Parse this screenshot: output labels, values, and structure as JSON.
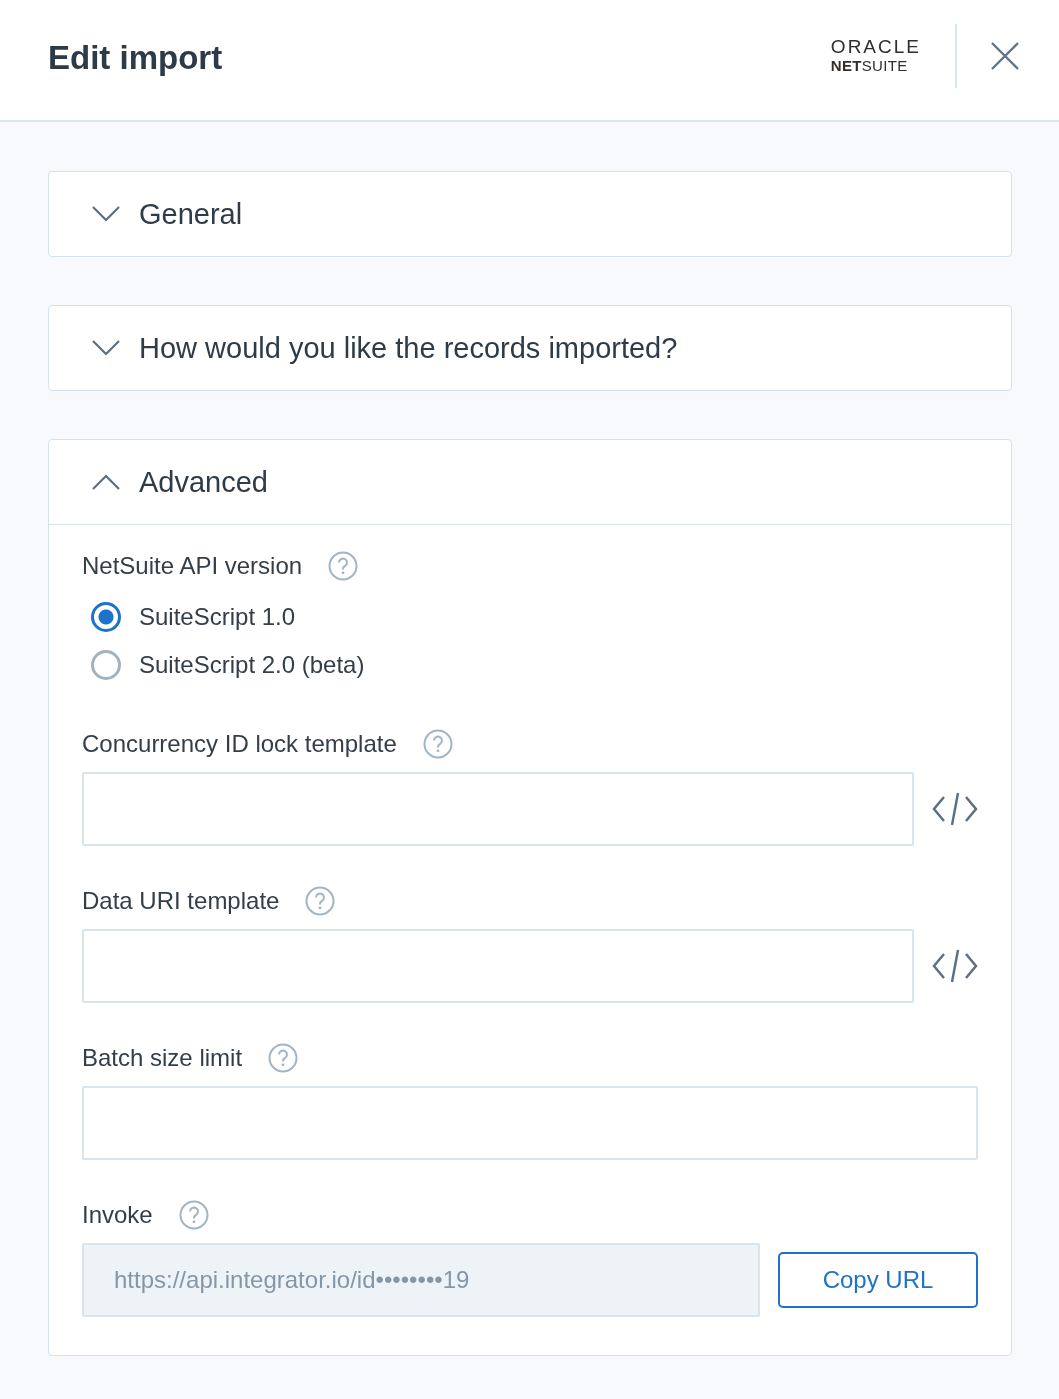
{
  "header": {
    "title": "Edit import",
    "logo": {
      "wordmark": "ORACLE",
      "product": "**NET**SUITE"
    }
  },
  "sections": [
    {
      "title": "General",
      "expanded": false
    },
    {
      "title": "How would you like the records imported?",
      "expanded": false
    },
    {
      "title": "Advanced",
      "expanded": true,
      "fields": [
        {
          "kind": "radio_group",
          "label": "NetSuite API version",
          "options": [
            {
              "label": "SuiteScript 1.0",
              "selected": true
            },
            {
              "label": "SuiteScript 2.0 (beta)",
              "selected": false
            }
          ]
        },
        {
          "kind": "template",
          "label": "Concurrency ID lock template"
        },
        {
          "kind": "template",
          "label": "Data URI template"
        },
        {
          "kind": "text",
          "label": "Batch size limit"
        },
        {
          "kind": "copy_url",
          "label": "Invoke",
          "value": "https://api.integrator.io/id••••••••19",
          "button": "Copy URL"
        }
      ]
    }
  ]
}
